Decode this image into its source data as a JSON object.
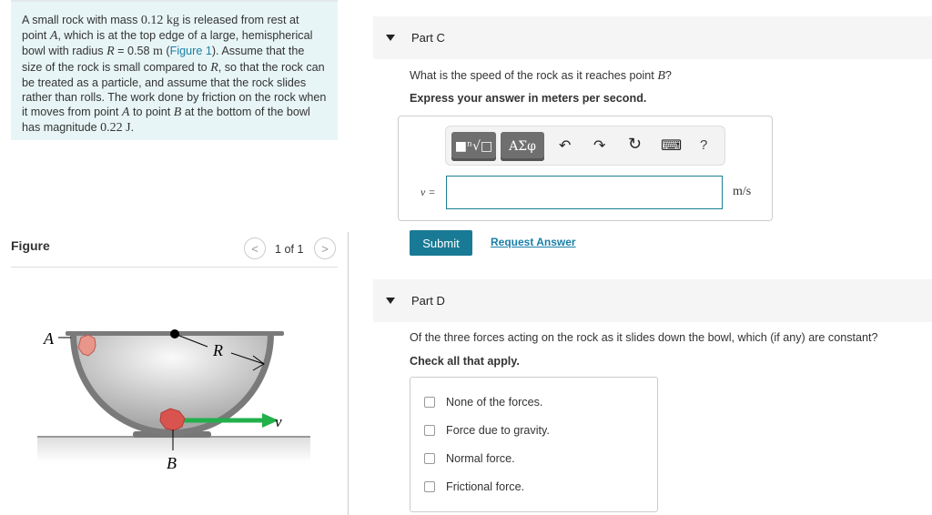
{
  "intro": {
    "t1": "A small rock with mass ",
    "mass": "0.12",
    "kg": "kg",
    "t2": " is released from rest at point ",
    "A": "A",
    "t3": ", which is at the top edge of a large, hemispherical bowl with radius ",
    "R": "R",
    "eq": " = 0.58 ",
    "m": "m",
    "t4": " (",
    "fig_link": "Figure 1",
    "t5": "). Assume that the size of the rock is small compared to ",
    "t6": ", so that the rock can be treated as a particle, and assume that the rock slides rather than rolls. The work done by friction on the rock when it moves from point ",
    "t7": " to point ",
    "B": "B",
    "t8": " at the bottom of the bowl has magnitude ",
    "work": "0.22 ",
    "J": "J",
    "t9": "."
  },
  "figure": {
    "label": "Figure",
    "pager": "1 of 1",
    "prev": "<",
    "next": ">",
    "labels": {
      "A": "A",
      "R": "R",
      "v": "v",
      "B": "B"
    },
    "colors": {
      "rock": "#d9534f",
      "arrow": "#22b04b"
    }
  },
  "partC": {
    "title": "Part C",
    "question": "What is the speed of the rock as it reaches point ",
    "qvar": "B",
    "qend": "?",
    "instruction": "Express your answer in meters per second.",
    "toolbar": {
      "templates": "■ⁿ√□",
      "greek": "ΑΣφ",
      "undo": "↶",
      "redo": "↷",
      "reset": "↻",
      "keyboard": "⌨",
      "help": "?"
    },
    "var_label": "v =",
    "input_value": "",
    "unit": "m/s",
    "submit": "Submit",
    "request": "Request Answer"
  },
  "partD": {
    "title": "Part D",
    "question": "Of the three forces acting on the rock as it slides down the bowl, which (if any) are constant?",
    "instruction": "Check all that apply.",
    "options": [
      "None of the forces.",
      "Force due to gravity.",
      "Normal force.",
      "Frictional force."
    ]
  },
  "colors": {
    "accent": "#197a96",
    "intro_bg": "#e8f5f6"
  }
}
